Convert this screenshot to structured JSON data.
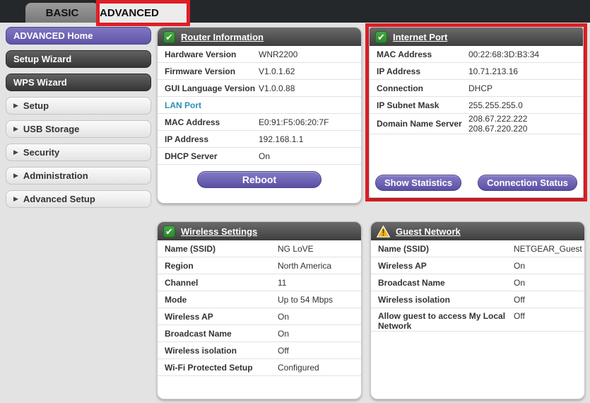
{
  "topbar": {
    "tabs": [
      {
        "label": "BASIC"
      },
      {
        "label": "ADVANCED"
      }
    ]
  },
  "sidebar": {
    "items": [
      {
        "label": "ADVANCED Home",
        "style": "active",
        "expandable": false
      },
      {
        "label": "Setup Wizard",
        "style": "dark",
        "expandable": false
      },
      {
        "label": "WPS Wizard",
        "style": "dark",
        "expandable": false
      },
      {
        "label": "Setup",
        "style": "expand",
        "expandable": true
      },
      {
        "label": "USB Storage",
        "style": "expand",
        "expandable": true
      },
      {
        "label": "Security",
        "style": "expand",
        "expandable": true
      },
      {
        "label": "Administration",
        "style": "expand",
        "expandable": true
      },
      {
        "label": "Advanced Setup",
        "style": "expand",
        "expandable": true
      }
    ]
  },
  "panels": {
    "router_info": {
      "title": "Router Information",
      "icon": "green-check",
      "rows": [
        {
          "label": "Hardware Version",
          "value": "WNR2200"
        },
        {
          "label": "Firmware Version",
          "value": "V1.0.1.62"
        },
        {
          "label": "GUI Language Version",
          "value": "V1.0.0.88"
        },
        {
          "section": "LAN Port"
        },
        {
          "label": "MAC Address",
          "value": "E0:91:F5:06:20:7F"
        },
        {
          "label": "IP Address",
          "value": "192.168.1.1"
        },
        {
          "label": "DHCP Server",
          "value": "On"
        }
      ],
      "reboot_label": "Reboot"
    },
    "internet_port": {
      "title": "Internet Port",
      "icon": "green-check",
      "highlighted": true,
      "rows": [
        {
          "label": "MAC Address",
          "value": "00:22:68:3D:B3:34"
        },
        {
          "label": "IP Address",
          "value": "10.71.213.16"
        },
        {
          "label": "Connection",
          "value": "DHCP"
        },
        {
          "label": "IP Subnet Mask",
          "value": "255.255.255.0"
        },
        {
          "label": "Domain Name Server",
          "value": "208.67.222.222\n208.67.220.220"
        }
      ],
      "buttons": {
        "show_statistics": "Show Statistics",
        "connection_status": "Connection Status"
      }
    },
    "wireless": {
      "title": "Wireless Settings",
      "icon": "green-check",
      "rows": [
        {
          "label": "Name (SSID)",
          "value": "NG LoVE"
        },
        {
          "label": "Region",
          "value": "North America"
        },
        {
          "label": "Channel",
          "value": "11"
        },
        {
          "label": "Mode",
          "value": "Up to 54 Mbps"
        },
        {
          "label": "Wireless AP",
          "value": "On"
        },
        {
          "label": "Broadcast Name",
          "value": "On"
        },
        {
          "label": "Wireless isolation",
          "value": "Off"
        },
        {
          "label": "Wi-Fi Protected Setup",
          "value": "Configured"
        }
      ]
    },
    "guest": {
      "title": "Guest Network",
      "icon": "warning",
      "rows": [
        {
          "label": "Name (SSID)",
          "value": "NETGEAR_Guest"
        },
        {
          "label": "Wireless AP",
          "value": "On"
        },
        {
          "label": "Broadcast Name",
          "value": "On"
        },
        {
          "label": "Wireless isolation",
          "value": "Off"
        },
        {
          "label": "Allow guest to access My Local Network",
          "value": "Off"
        }
      ]
    }
  },
  "colors": {
    "highlight_red": "#de1f26",
    "accent_purple": "#6a61b0",
    "check_green": "#3a9a3a",
    "warning_yellow": "#f3b51a",
    "link_blue": "#2a91b5",
    "topbar_black": "#25282a"
  }
}
